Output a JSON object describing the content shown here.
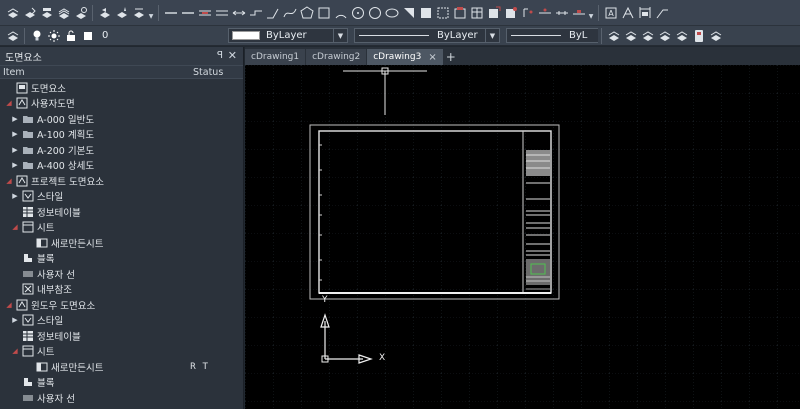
{
  "toolbar2": {
    "layer_value": "0",
    "color_value": "ByLayer",
    "linetype_value": "ByLayer",
    "lineweight_value": "ByL"
  },
  "panel": {
    "title": "도면요소",
    "col_item": "Item",
    "col_status": "Status",
    "rows": [
      {
        "label": "도면요소",
        "status": ""
      },
      {
        "label": "사용자도면",
        "status": ""
      },
      {
        "label": "A-000 일반도",
        "status": ""
      },
      {
        "label": "A-100 계획도",
        "status": ""
      },
      {
        "label": "A-200 기본도",
        "status": ""
      },
      {
        "label": "A-400 상세도",
        "status": ""
      },
      {
        "label": "프로젝트 도면요소",
        "status": ""
      },
      {
        "label": "스타일",
        "status": ""
      },
      {
        "label": "정보테이블",
        "status": ""
      },
      {
        "label": "시트",
        "status": ""
      },
      {
        "label": "새로만든시트",
        "status": ""
      },
      {
        "label": "블록",
        "status": ""
      },
      {
        "label": "사용자 선",
        "status": ""
      },
      {
        "label": "내부참조",
        "status": ""
      },
      {
        "label": "윈도우 도면요소",
        "status": ""
      },
      {
        "label": "스타일",
        "status": ""
      },
      {
        "label": "정보테이블",
        "status": ""
      },
      {
        "label": "시트",
        "status": ""
      },
      {
        "label": "새로만든시트",
        "status": "R T"
      },
      {
        "label": "블록",
        "status": ""
      },
      {
        "label": "사용자 선",
        "status": ""
      }
    ]
  },
  "tabs": [
    {
      "label": "cDrawing1"
    },
    {
      "label": "cDrawing2"
    },
    {
      "label": "cDrawing3",
      "close": "×"
    }
  ],
  "tab_add": "+",
  "ucs": {
    "y_label": "Y",
    "x_label": "X"
  },
  "colors": {
    "accent_red": "#c04b4b",
    "canvas_bg": "#000000",
    "panel_bg": "#2b323b",
    "toolbar_bg": "#3b4451"
  }
}
